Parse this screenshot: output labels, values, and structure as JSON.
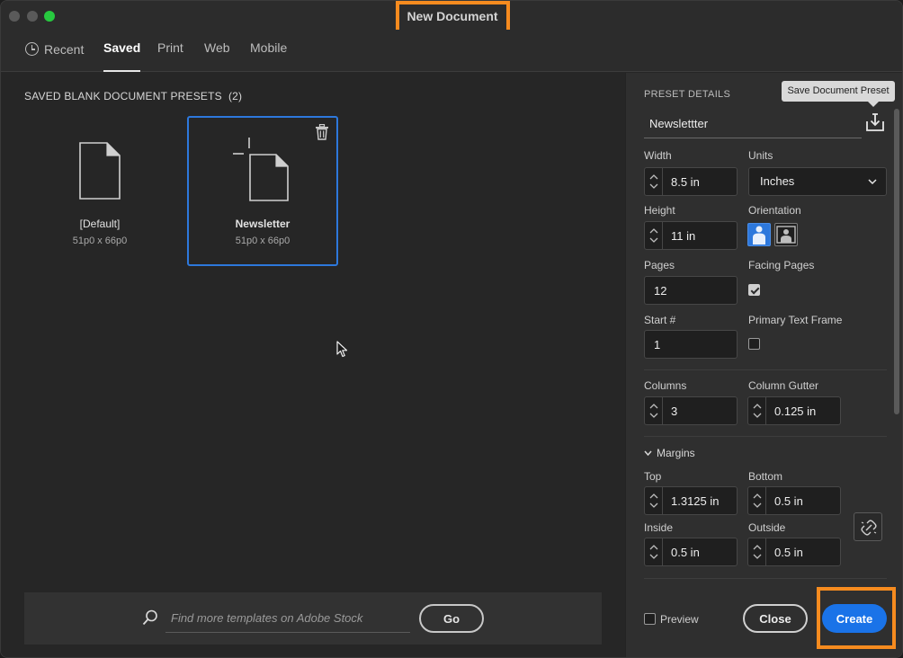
{
  "window": {
    "title": "New Document"
  },
  "tabs": [
    {
      "label": "Recent",
      "icon": "clock-icon"
    },
    {
      "label": "Saved",
      "active": true
    },
    {
      "label": "Print"
    },
    {
      "label": "Web"
    },
    {
      "label": "Mobile"
    }
  ],
  "presets": {
    "section_title": "SAVED BLANK DOCUMENT PRESETS",
    "count": "(2)",
    "items": [
      {
        "name": "[Default]",
        "size": "51p0 x 66p0",
        "selected": false
      },
      {
        "name": "Newsletter",
        "size": "51p0 x 66p0",
        "selected": true
      }
    ]
  },
  "stock": {
    "placeholder": "Find more templates on Adobe Stock",
    "go_label": "Go"
  },
  "details": {
    "title": "PRESET DETAILS",
    "tooltip": "Save Document Preset",
    "preset_name": "Newslettter",
    "width_label": "Width",
    "width_value": "8.5 in",
    "units_label": "Units",
    "units_value": "Inches",
    "height_label": "Height",
    "height_value": "11 in",
    "orientation_label": "Orientation",
    "orientation_value": "portrait",
    "pages_label": "Pages",
    "pages_value": "12",
    "facing_pages_label": "Facing Pages",
    "facing_pages_checked": true,
    "start_label": "Start #",
    "start_value": "1",
    "primary_text_frame_label": "Primary Text Frame",
    "primary_text_frame_checked": false,
    "columns_label": "Columns",
    "columns_value": "3",
    "column_gutter_label": "Column Gutter",
    "column_gutter_value": "0.125 in",
    "margins_label": "Margins",
    "top_label": "Top",
    "top_value": "1.3125 in",
    "bottom_label": "Bottom",
    "bottom_value": "0.5 in",
    "inside_label": "Inside",
    "inside_value": "0.5 in",
    "outside_label": "Outside",
    "outside_value": "0.5 in"
  },
  "footer": {
    "preview_label": "Preview",
    "preview_checked": false,
    "close_label": "Close",
    "create_label": "Create"
  },
  "colors": {
    "accent": "#1a73e8",
    "selection": "#2d78dc",
    "highlight": "#f68b1f",
    "background": "#262626"
  }
}
